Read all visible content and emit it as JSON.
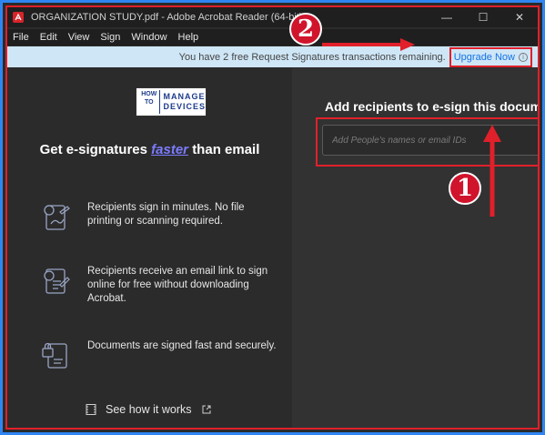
{
  "window": {
    "title": "ORGANIZATION STUDY.pdf - Adobe Acrobat Reader (64-bit)",
    "minimize_glyph": "—",
    "maximize_glyph": "☐",
    "close_glyph": "✕"
  },
  "menu": [
    "File",
    "Edit",
    "View",
    "Sign",
    "Window",
    "Help"
  ],
  "banner": {
    "message": "You have 2 free Request Signatures transactions remaining.",
    "link": "Upgrade Now",
    "info_glyph": "i"
  },
  "logo": {
    "line1": "HOW",
    "line2": "TO",
    "word1": "MANAGE",
    "word2": "DEVICES"
  },
  "left": {
    "headline_pre": "Get e-signatures",
    "headline_em": "faster",
    "headline_post": "than email",
    "features": [
      {
        "icon": "sign-document-icon",
        "text": "Recipients sign in minutes. No file printing or scanning required."
      },
      {
        "icon": "email-document-icon",
        "text": "Recipients receive an email link to sign online for free without downloading Acrobat."
      },
      {
        "icon": "secure-document-icon",
        "text": "Documents are signed fast and securely."
      }
    ],
    "how_it_works": "See how it works"
  },
  "right": {
    "title": "Add recipients to e-sign this document",
    "input_placeholder": "Add People's names or email IDs"
  },
  "annotations": {
    "badge1": "1",
    "badge2": "2"
  },
  "colors": {
    "annotation_red": "#e0202a",
    "frame_blue": "#2f86f3",
    "link_blue": "#1473e6",
    "banner_bg": "#cfe6f6"
  }
}
